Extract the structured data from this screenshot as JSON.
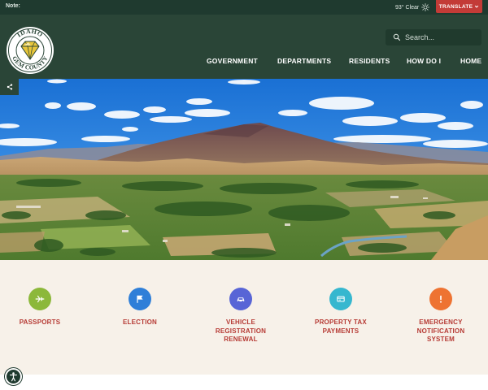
{
  "topbar": {
    "note": "Note:",
    "weather": "93° Clear",
    "translate_label": "TRANSLATE"
  },
  "header": {
    "logo_text_top": "IDAHO",
    "logo_text_bottom": "GEM COUNTY",
    "search_placeholder": "Search...",
    "nav": [
      {
        "label": "GOVERNMENT"
      },
      {
        "label": "DEPARTMENTS"
      },
      {
        "label": "RESIDENTS"
      },
      {
        "label": "HOW DO I"
      },
      {
        "label": "HOME"
      }
    ]
  },
  "hero": {
    "image": "mountain-valley-landscape"
  },
  "quick_links": [
    {
      "label": "PASSPORTS",
      "icon": "airplane-icon",
      "color": "#8cb83a"
    },
    {
      "label": "ELECTION",
      "icon": "flag-icon",
      "color": "#2f7fd8"
    },
    {
      "label": "VEHICLE\nREGISTRATION\nRENEWAL",
      "icon": "car-icon",
      "color": "#5865d6"
    },
    {
      "label": "PROPERTY TAX\nPAYMENTS",
      "icon": "card-icon",
      "color": "#36b7cf"
    },
    {
      "label": "EMERGENCY\nNOTIFICATION\nSYSTEM",
      "icon": "alert-icon",
      "color": "#ee7332"
    }
  ],
  "colors": {
    "topbar": "#1f3a2f",
    "header": "#2a4537",
    "accent_red": "#c33b37",
    "label_red": "#b63a34",
    "quick_bg": "#f7f1e9"
  }
}
